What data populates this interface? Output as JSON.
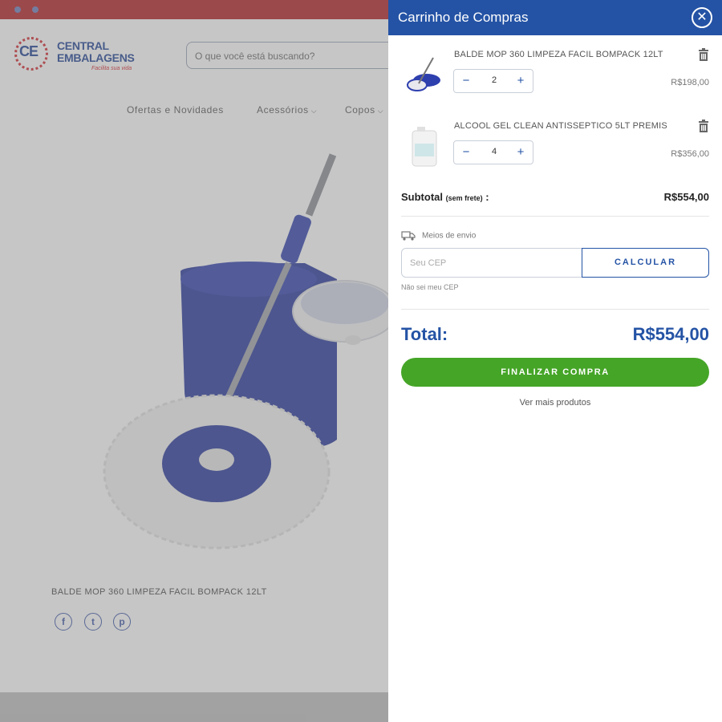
{
  "store": {
    "logo": {
      "mark": "CE",
      "line1": "CENTRAL",
      "line2": "EMBALAGENS",
      "tagline": "Facilita sua vida"
    },
    "search": {
      "placeholder": "O que você está buscando?"
    },
    "nav": [
      {
        "label": "Ofertas e Novidades",
        "dropdown": false
      },
      {
        "label": "Acessórios",
        "dropdown": true
      },
      {
        "label": "Copos",
        "dropdown": true
      }
    ],
    "product": {
      "title": "BALDE MOP 360 LIMPEZA FACIL BOMPACK 12LT"
    },
    "social": [
      {
        "icon": "facebook-icon",
        "glyph": "f"
      },
      {
        "icon": "twitter-icon",
        "glyph": "t"
      },
      {
        "icon": "pinterest-icon",
        "glyph": "p"
      }
    ],
    "colors": {
      "topbar": "#b21c22",
      "brand_blue": "#1b3f93"
    }
  },
  "cart": {
    "title": "Carrinho de Compras",
    "items": [
      {
        "name": "BALDE MOP 360 LIMPEZA FACIL BOMPACK 12LT",
        "qty": "2",
        "price": "R$198,00",
        "thumb_icon": "mop-bucket-icon"
      },
      {
        "name": "ALCOOL GEL CLEAN ANTISSEPTICO 5LT PREMIS",
        "qty": "4",
        "price": "R$356,00",
        "thumb_icon": "gel-jug-icon"
      }
    ],
    "subtotal": {
      "label": "Subtotal",
      "note": "(sem frete)",
      "suffix": " :",
      "value": "R$554,00"
    },
    "shipping": {
      "label": "Meios de envio",
      "cep_placeholder": "Seu CEP",
      "calc_label": "CALCULAR",
      "unknown_cep": "Não sei meu CEP"
    },
    "total": {
      "label": "Total:",
      "value": "R$554,00"
    },
    "checkout_label": "FINALIZAR COMPRA",
    "more_label": "Ver mais produtos",
    "colors": {
      "header": "#2453a5",
      "checkout": "#45a527"
    }
  }
}
